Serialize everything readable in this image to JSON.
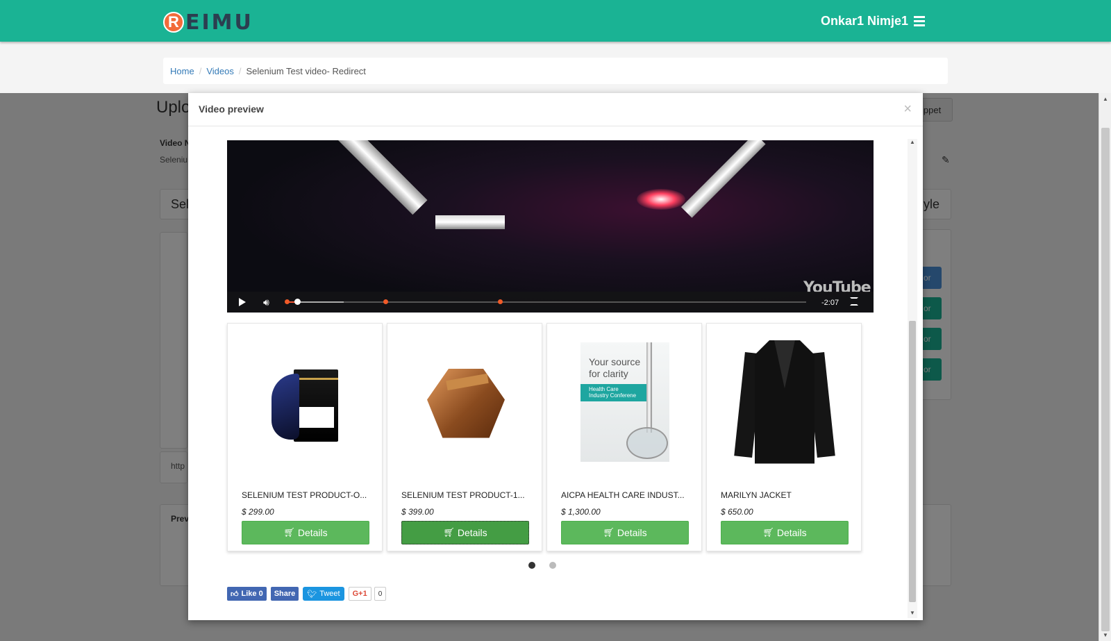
{
  "header": {
    "logo_letter": "R",
    "logo_text": "EIMU",
    "user_name": "Onkar1 Nimje1",
    "menu_icon": "hamburger-icon"
  },
  "breadcrumb": {
    "home": "Home",
    "videos": "Videos",
    "current": "Selenium Test video- Redirect"
  },
  "background_page": {
    "title": "Uplo",
    "video_label": "Video N",
    "video_value": "Seleniu",
    "section_text": "Sel",
    "snippet_button": "ippet",
    "style_text": "yle",
    "url_text": "http",
    "preview_text": "Prev",
    "side_button_text": "or"
  },
  "modal": {
    "title": "Video preview",
    "close": "×"
  },
  "video": {
    "time_remaining": "-2:07",
    "logo": "YouTube",
    "progress_fraction": 0.02,
    "loaded_fraction": 0.11,
    "cue_fractions": [
      0.0,
      0.19,
      0.41
    ]
  },
  "products": [
    {
      "name": "SELENIUM TEST PRODUCT-O...",
      "price": "$ 299.00",
      "button": "Details",
      "image": "perfume-shoe-image"
    },
    {
      "name": "SELENIUM TEST PRODUCT-1...",
      "price": "$ 399.00",
      "button": "Details",
      "image": "perfume-bottle-image"
    },
    {
      "name": "AICPA HEALTH CARE INDUST...",
      "price": "$ 1,300.00",
      "button": "Details",
      "image": "conference-poster-image"
    },
    {
      "name": "MARILYN JACKET",
      "price": "$ 650.00",
      "button": "Details",
      "image": "jacket-image"
    }
  ],
  "poster": {
    "line1": "Your source",
    "line2": "for clarity",
    "band1": "Health Care",
    "band2": "Industry Conferene"
  },
  "carousel": {
    "pages": 2,
    "active": 1
  },
  "social": {
    "like": "Like 0",
    "share": "Share",
    "tweet": "Tweet",
    "gplus": "G+1",
    "gplus_count": "0"
  },
  "colors": {
    "brand": "#1ab394",
    "button": "#5cb85c",
    "link": "#337ab7"
  }
}
